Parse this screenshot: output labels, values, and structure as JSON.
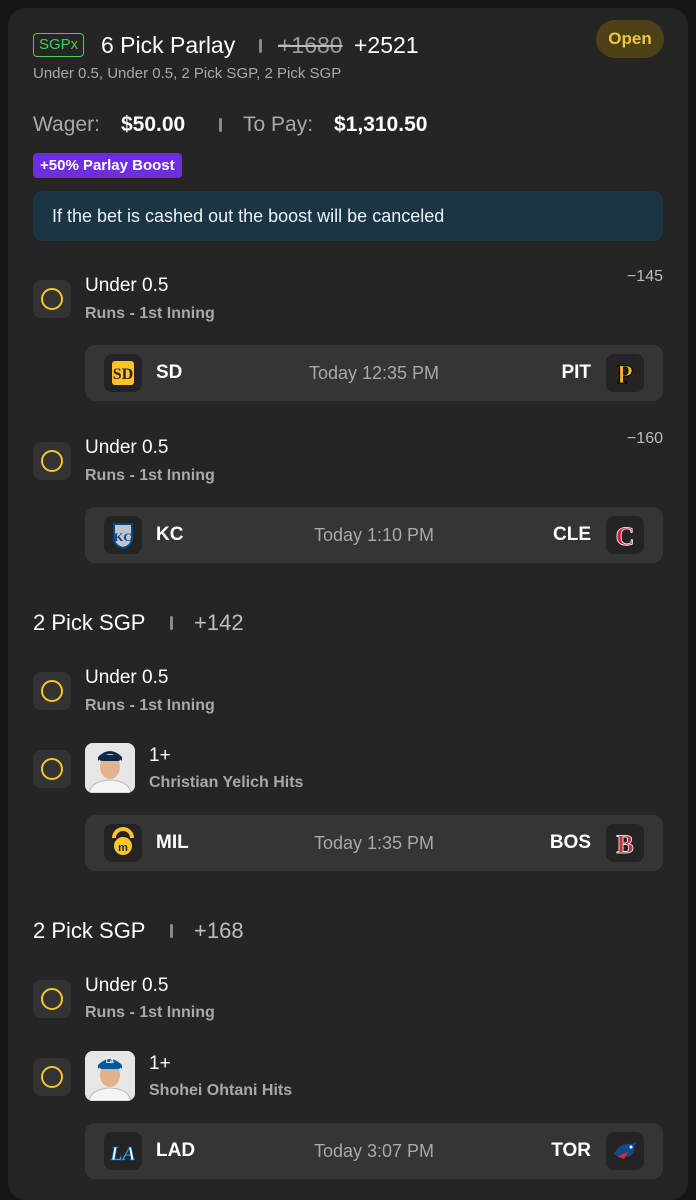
{
  "header": {
    "badge": "SGPx",
    "title": "6 Pick Parlay",
    "original_odds": "+1680",
    "boosted_odds": "+2521",
    "status": "Open",
    "subtitle": "Under 0.5, Under 0.5, 2 Pick SGP, 2 Pick SGP"
  },
  "wager": {
    "wager_label": "Wager:",
    "wager_value": "$50.00",
    "payout_label": "To Pay:",
    "payout_value": "$1,310.50"
  },
  "boost_badge": "+50% Parlay Boost",
  "notice": "If the bet is cashed out the boost will be canceled",
  "legs": [
    {
      "title": "Under 0.5",
      "subtitle": "Runs - 1st Inning",
      "odds": "−145",
      "game": {
        "away": "SD",
        "time": "Today 12:35 PM",
        "home": "PIT"
      }
    },
    {
      "title": "Under 0.5",
      "subtitle": "Runs - 1st Inning",
      "odds": "−160",
      "game": {
        "away": "KC",
        "time": "Today 1:10 PM",
        "home": "CLE"
      }
    }
  ],
  "sgps": [
    {
      "title": "2 Pick SGP",
      "odds": "+142",
      "leg1": {
        "title": "Under 0.5",
        "subtitle": "Runs - 1st Inning"
      },
      "leg2": {
        "title": "1+",
        "subtitle": "Christian Yelich Hits"
      },
      "game": {
        "away": "MIL",
        "time": "Today 1:35 PM",
        "home": "BOS"
      }
    },
    {
      "title": "2 Pick SGP",
      "odds": "+168",
      "leg1": {
        "title": "Under 0.5",
        "subtitle": "Runs - 1st Inning"
      },
      "leg2": {
        "title": "1+",
        "subtitle": "Shohei Ohtani Hits"
      },
      "game": {
        "away": "LAD",
        "time": "Today 3:07 PM",
        "home": "TOR"
      }
    }
  ],
  "icons": {
    "status": "pending-circle-icon",
    "team_logos": [
      "padres-logo-icon",
      "pirates-logo-icon",
      "royals-logo-icon",
      "guardians-logo-icon",
      "brewers-logo-icon",
      "red-sox-logo-icon",
      "dodgers-logo-icon",
      "blue-jays-logo-icon"
    ],
    "players": [
      "christian-yelich-avatar",
      "shohei-ohtani-avatar"
    ]
  },
  "colors": {
    "background": "#252525",
    "accent_green": "#3ed34a",
    "status_yellow": "#efc53c",
    "boost_purple": "#6e2ee0",
    "notice_bg": "#1c3545"
  }
}
